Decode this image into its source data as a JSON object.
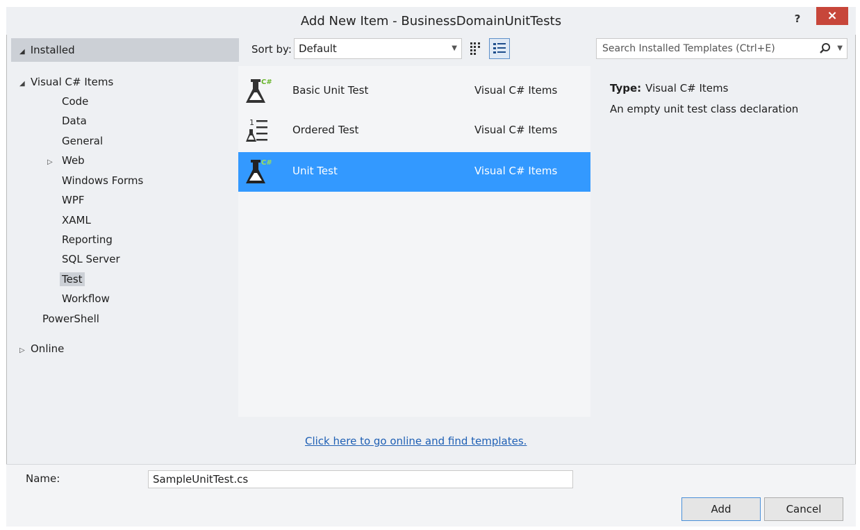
{
  "window": {
    "title": "Add New Item - BusinessDomainUnitTests",
    "help_label": "?",
    "close_label": "×"
  },
  "sidebar": {
    "installed_label": "Installed",
    "items": [
      {
        "label": "Visual C# Items",
        "level": 0,
        "expander": "expanded"
      },
      {
        "label": "Code",
        "level": 1
      },
      {
        "label": "Data",
        "level": 1
      },
      {
        "label": "General",
        "level": 1
      },
      {
        "label": "Web",
        "level": 1,
        "expander": "collapsed"
      },
      {
        "label": "Windows Forms",
        "level": 1
      },
      {
        "label": "WPF",
        "level": 1
      },
      {
        "label": "XAML",
        "level": 1
      },
      {
        "label": "Reporting",
        "level": 1
      },
      {
        "label": "SQL Server",
        "level": 1
      },
      {
        "label": "Test",
        "level": 1,
        "selected": true
      },
      {
        "label": "Workflow",
        "level": 1
      },
      {
        "label": "PowerShell",
        "level": 0
      }
    ],
    "online_label": "Online"
  },
  "toolbar": {
    "sort_label": "Sort by:",
    "sort_value": "Default",
    "view_icons": [
      "small-icons-view-icon",
      "list-view-icon"
    ]
  },
  "search": {
    "placeholder": "Search Installed Templates (Ctrl+E)"
  },
  "templates": [
    {
      "name": "Basic Unit Test",
      "category": "Visual C# Items",
      "icon": "unit-test-flask-icon",
      "selected": false
    },
    {
      "name": "Ordered Test",
      "category": "Visual C# Items",
      "icon": "ordered-test-icon",
      "selected": false
    },
    {
      "name": "Unit Test",
      "category": "Visual C# Items",
      "icon": "unit-test-flask-icon",
      "selected": true
    }
  ],
  "details": {
    "type_label": "Type:",
    "type_value": "Visual C# Items",
    "description": "An empty unit test class declaration"
  },
  "online_link": "Click here to go online and find templates.",
  "form": {
    "name_label": "Name:",
    "name_value": "SampleUnitTest.cs"
  },
  "buttons": {
    "add": "Add",
    "cancel": "Cancel"
  },
  "colors": {
    "selection": "#3399ff",
    "close_button": "#c7463a",
    "link": "#1e5fb4"
  }
}
